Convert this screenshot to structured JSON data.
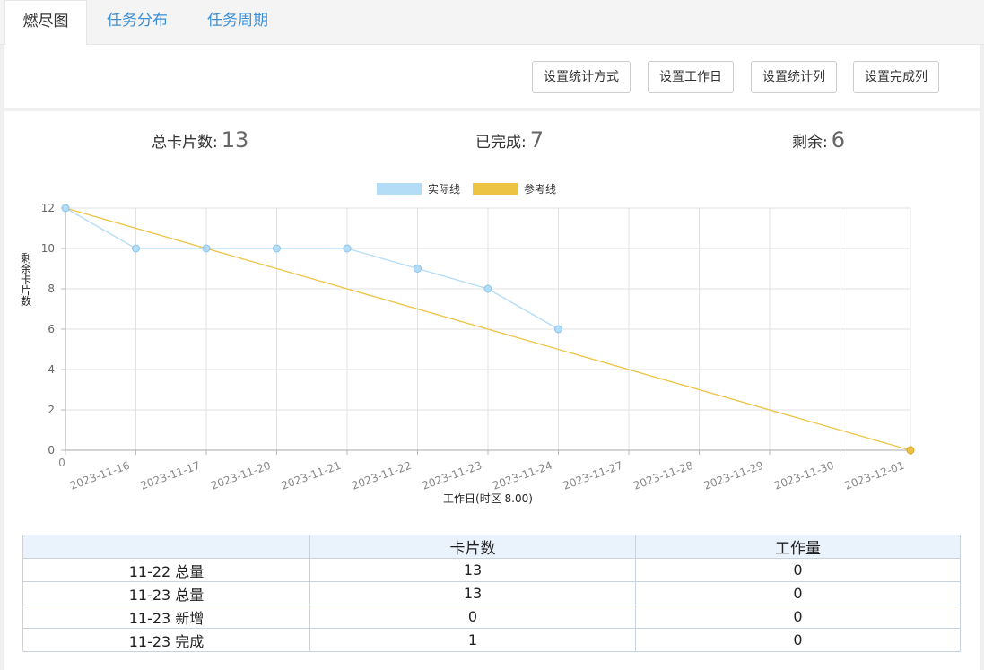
{
  "tabs": [
    {
      "label": "燃尽图",
      "active": true
    },
    {
      "label": "任务分布",
      "active": false
    },
    {
      "label": "任务周期",
      "active": false
    }
  ],
  "toolbar": {
    "buttons": [
      "设置统计方式",
      "设置工作日",
      "设置统计列",
      "设置完成列"
    ]
  },
  "stats": {
    "total_label": "总卡片数:",
    "total_value": "13",
    "done_label": "已完成:",
    "done_value": "7",
    "remaining_label": "剩余:",
    "remaining_value": "6"
  },
  "chart_data": {
    "type": "line",
    "categories": [
      "2023-11-16",
      "2023-11-17",
      "2023-11-20",
      "2023-11-21",
      "2023-11-22",
      "2023-11-23",
      "2023-11-24",
      "2023-11-27",
      "2023-11-28",
      "2023-11-29",
      "2023-11-30",
      "2023-12-01"
    ],
    "x_origin_label": "0",
    "series": [
      {
        "name": "实际线",
        "color": "#b3dcf7",
        "x_index": [
          0,
          1,
          2,
          3,
          4,
          5,
          6,
          7
        ],
        "values": [
          12,
          10,
          10,
          10,
          10,
          9,
          8,
          6
        ]
      },
      {
        "name": "参考线",
        "color": "#edc344",
        "x_index": [
          0,
          12
        ],
        "values": [
          12,
          0
        ]
      }
    ],
    "xlabel": "工作日(时区 8.00)",
    "ylabel": "剩余卡片数",
    "ylim": [
      0,
      12
    ],
    "yticks": [
      0,
      2,
      4,
      6,
      8,
      10,
      12
    ],
    "grid": true,
    "legend_position": "top-center"
  },
  "table": {
    "headers": [
      "",
      "卡片数",
      "工作量"
    ],
    "rows": [
      [
        "11-22 总量",
        "13",
        "0"
      ],
      [
        "11-23 总量",
        "13",
        "0"
      ],
      [
        "11-23 新增",
        "0",
        "0"
      ],
      [
        "11-23 完成",
        "1",
        "0"
      ]
    ]
  }
}
